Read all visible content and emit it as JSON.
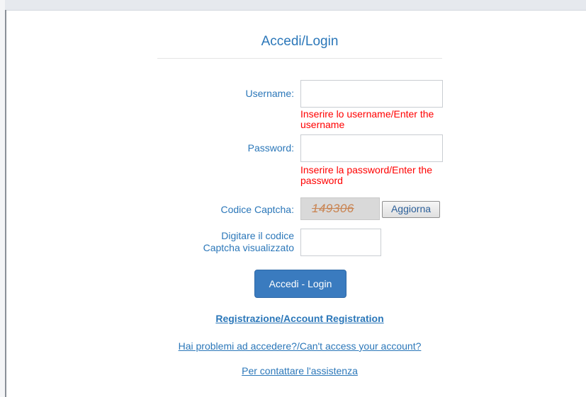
{
  "page": {
    "title": "Accedi/Login"
  },
  "form": {
    "username_label": "Username:",
    "username_value": "",
    "username_error": "Inserire lo username/Enter the username",
    "password_label": "Password:",
    "password_value": "",
    "password_error": "Inserire la password/Enter the password",
    "captcha_label": "Codice Captcha:",
    "captcha_code": "149306",
    "captcha_refresh_label": "Aggiorna",
    "captcha_input_label": "Digitare il codice Captcha visualizzato",
    "captcha_input_value": "",
    "submit_label": "Accedi - Login"
  },
  "links": {
    "register": "Registrazione/Account Registration",
    "cant_access": "Hai problemi ad accedere?/Can't access your account?",
    "support": "Per contattare l'assistenza"
  },
  "colors": {
    "accent": "#2b77b9",
    "error": "#ff0000",
    "button": "#3a7bbf"
  }
}
